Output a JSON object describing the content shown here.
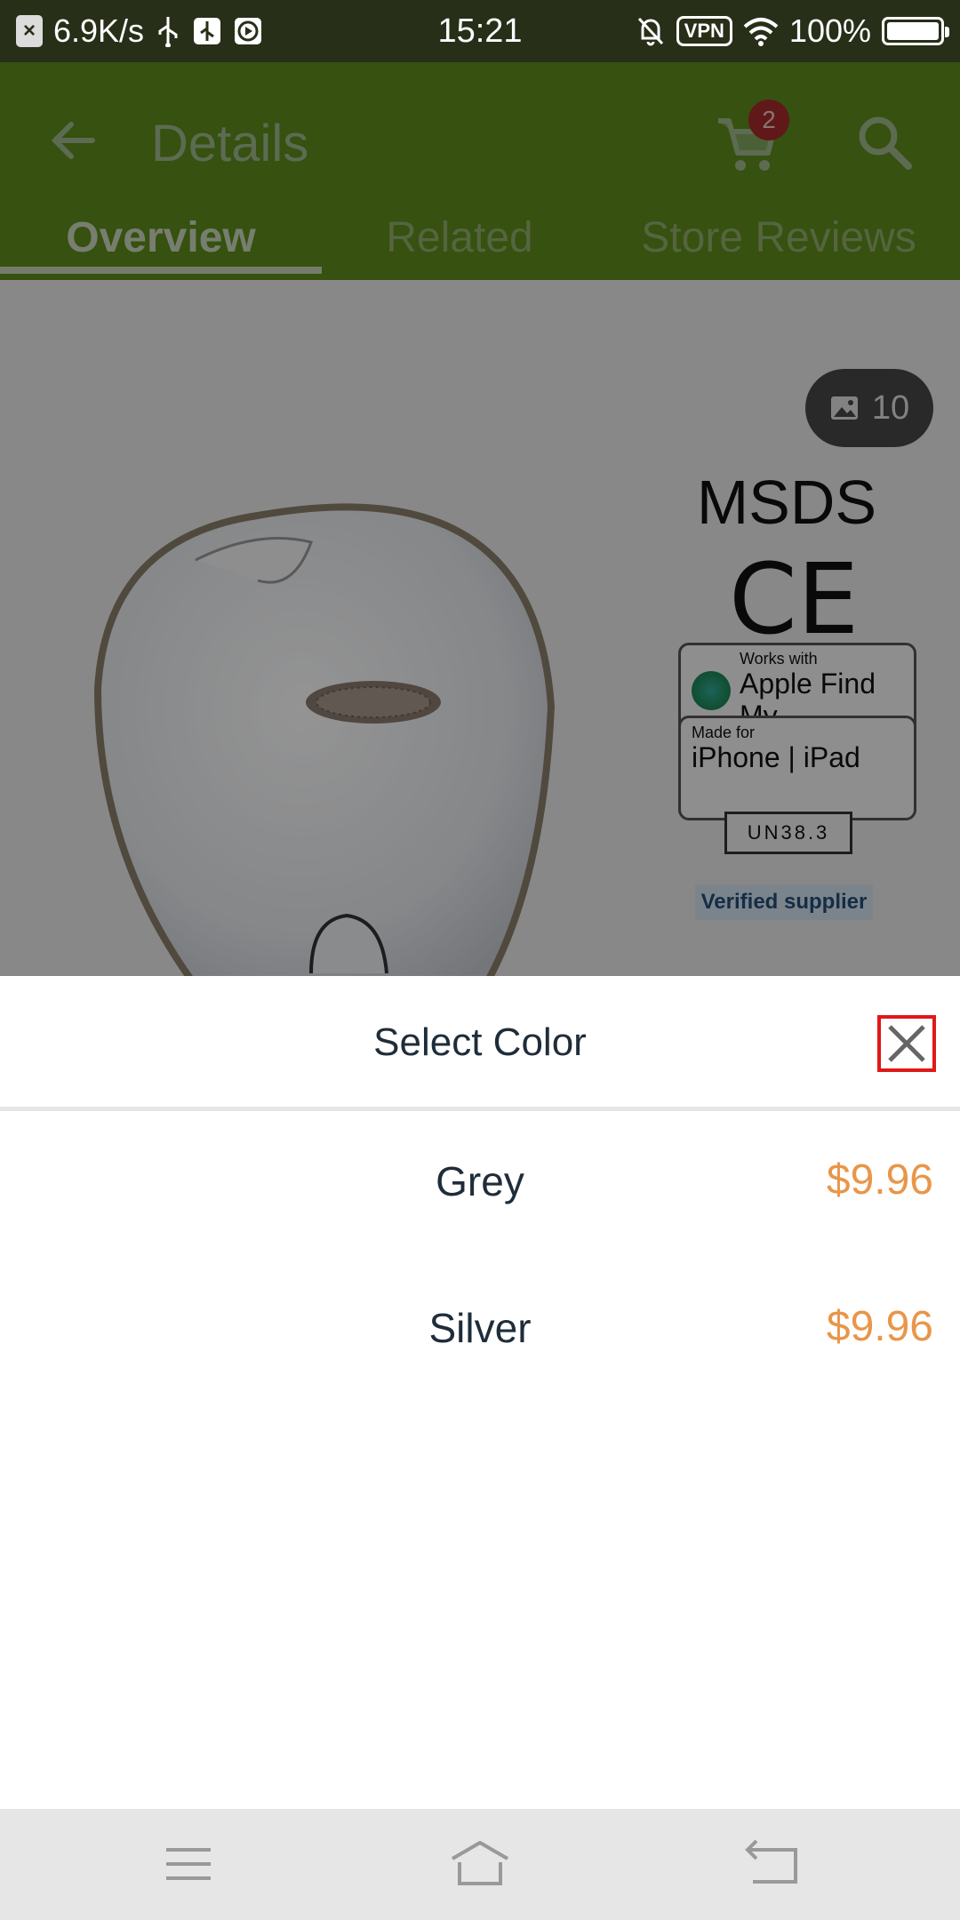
{
  "status_bar": {
    "network_speed": "6.9K/s",
    "time": "15:21",
    "vpn_label": "VPN",
    "battery": "100%",
    "battery_level": 1.0
  },
  "app_bar": {
    "title": "Details",
    "cart_count": "2",
    "icons": [
      "back-arrow-icon",
      "cart-icon",
      "search-icon"
    ]
  },
  "tabs": [
    {
      "label": "Overview",
      "active": true
    },
    {
      "label": "Related",
      "active": false
    },
    {
      "label": "Store Reviews",
      "active": false
    }
  ],
  "product": {
    "image_count": "10",
    "cert_msds": "MSDS",
    "cert_ce": "CE",
    "badge_findmy_small": "Works with",
    "badge_findmy_big": "Apple Find My",
    "badge_iphone_small": "Made for",
    "badge_iphone_big": " iPhone | iPad",
    "un_label": "UN38.3",
    "verified_label": "Verified supplier"
  },
  "sheet": {
    "title": "Select Color",
    "options": [
      {
        "name": "Grey",
        "price": "$9.96"
      },
      {
        "name": "Silver",
        "price": "$9.96"
      }
    ]
  },
  "colors": {
    "app_bar": "#5d8c1c",
    "price": "#e8964a",
    "close_outline": "#e01818"
  }
}
